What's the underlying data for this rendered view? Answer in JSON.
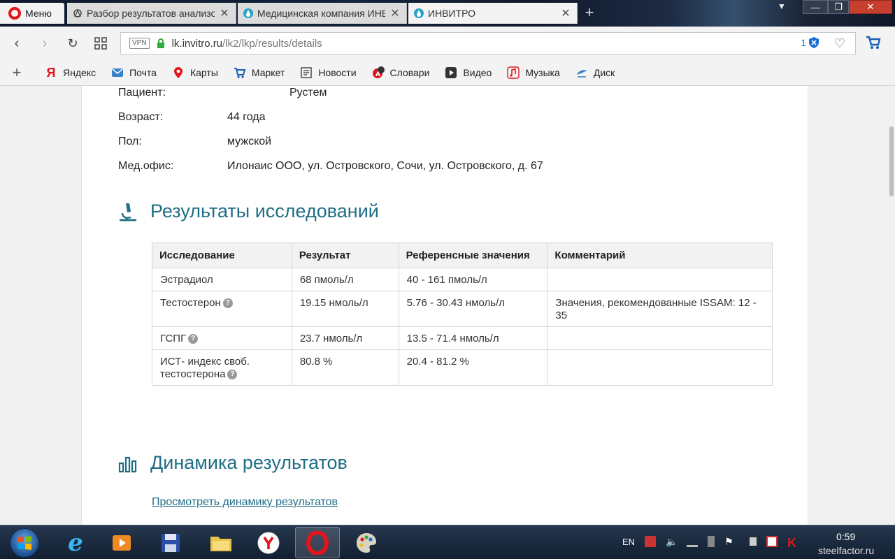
{
  "browser": {
    "menu_label": "Меню",
    "tabs": [
      {
        "title": "Разбор результатов анализов",
        "active": false
      },
      {
        "title": "Медицинская компания ИНВИТРО",
        "active": false
      },
      {
        "title": "ИНВИТРО",
        "active": true
      }
    ],
    "url": {
      "vpn_label": "VPN",
      "host": "lk.invitro.ru",
      "path": "/lk2/lkp/results/details"
    },
    "adblock_count": "1",
    "bookmarks": [
      {
        "label": "Яндекс",
        "icon": "yandex-icon"
      },
      {
        "label": "Почта",
        "icon": "mail-icon"
      },
      {
        "label": "Карты",
        "icon": "map-pin-icon"
      },
      {
        "label": "Маркет",
        "icon": "cart-icon"
      },
      {
        "label": "Новости",
        "icon": "news-icon"
      },
      {
        "label": "Словари",
        "icon": "dictionary-icon"
      },
      {
        "label": "Видео",
        "icon": "video-icon"
      },
      {
        "label": "Музыка",
        "icon": "music-icon"
      },
      {
        "label": "Диск",
        "icon": "disk-icon"
      }
    ]
  },
  "patient": {
    "patient_label": "Пациент:",
    "patient_name": "Рустем",
    "age_label": "Возраст:",
    "age_value": "44 года",
    "sex_label": "Пол:",
    "sex_value": "мужской",
    "office_label": "Мед.офис:",
    "office_value": "Илонаис ООО, ул. Островского, Сочи, ул. Островского, д. 67"
  },
  "results_section": {
    "title": "Результаты исследований",
    "headers": [
      "Исследование",
      "Результат",
      "Референсные значения",
      "Комментарий"
    ],
    "rows": [
      {
        "test": "Эстрадиол",
        "help": false,
        "result": "68 пмоль/л",
        "reference": "40 - 161 пмоль/л",
        "comment": ""
      },
      {
        "test": "Тестостерон",
        "help": true,
        "result": "19.15 нмоль/л",
        "reference": "5.76 - 30.43 нмоль/л",
        "comment": "Значения, рекомендованные ISSAM: 12 - 35"
      },
      {
        "test": "ГСПГ",
        "help": true,
        "result": "23.7 нмоль/л",
        "reference": "13.5 - 71.4 нмоль/л",
        "comment": ""
      },
      {
        "test": "ИСТ- индекс своб. тестостерона",
        "help": true,
        "result": "80.8 %",
        "reference": "20.4 - 81.2 %",
        "comment": ""
      }
    ]
  },
  "dynamics_section": {
    "title": "Динамика результатов",
    "link_label": "Просмотреть динамику результатов"
  },
  "taskbar": {
    "language": "EN",
    "time": "0:59",
    "watermark": "steelfactor.ru"
  },
  "colors": {
    "accent_teal": "#1f6e86",
    "opera_red": "#e0161c"
  }
}
